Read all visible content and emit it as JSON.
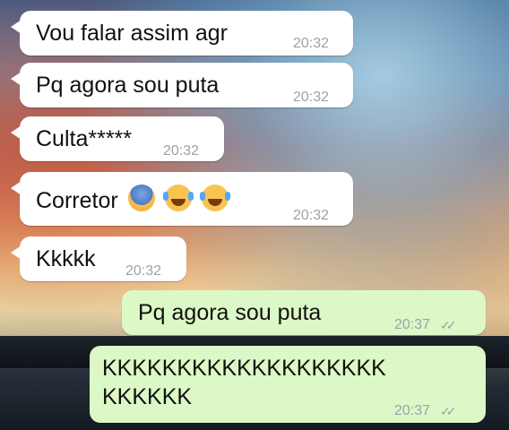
{
  "messages": [
    {
      "text": "Vou falar assim agr",
      "time": "20:32"
    },
    {
      "text": "Pq agora sou puta",
      "time": "20:32"
    },
    {
      "text": "Culta*****",
      "time": "20:32"
    },
    {
      "text": "Corretor",
      "time": "20:32",
      "emojis": [
        "fearful-face",
        "face-with-tears-of-joy",
        "face-with-tears-of-joy"
      ]
    },
    {
      "text": "Kkkkk",
      "time": "20:32"
    },
    {
      "text": "Pq agora sou puta",
      "time": "20:37",
      "status": "read-double-check"
    },
    {
      "text_line1": "KKKKKKKKKKKKKKKKKKK",
      "text_line2": "KKKKKK",
      "time": "20:37",
      "status": "read-double-check"
    }
  ],
  "colors": {
    "incoming_bubble": "#ffffff",
    "outgoing_bubble": "#dcf8c6",
    "timestamp": "#9aa3a6"
  }
}
